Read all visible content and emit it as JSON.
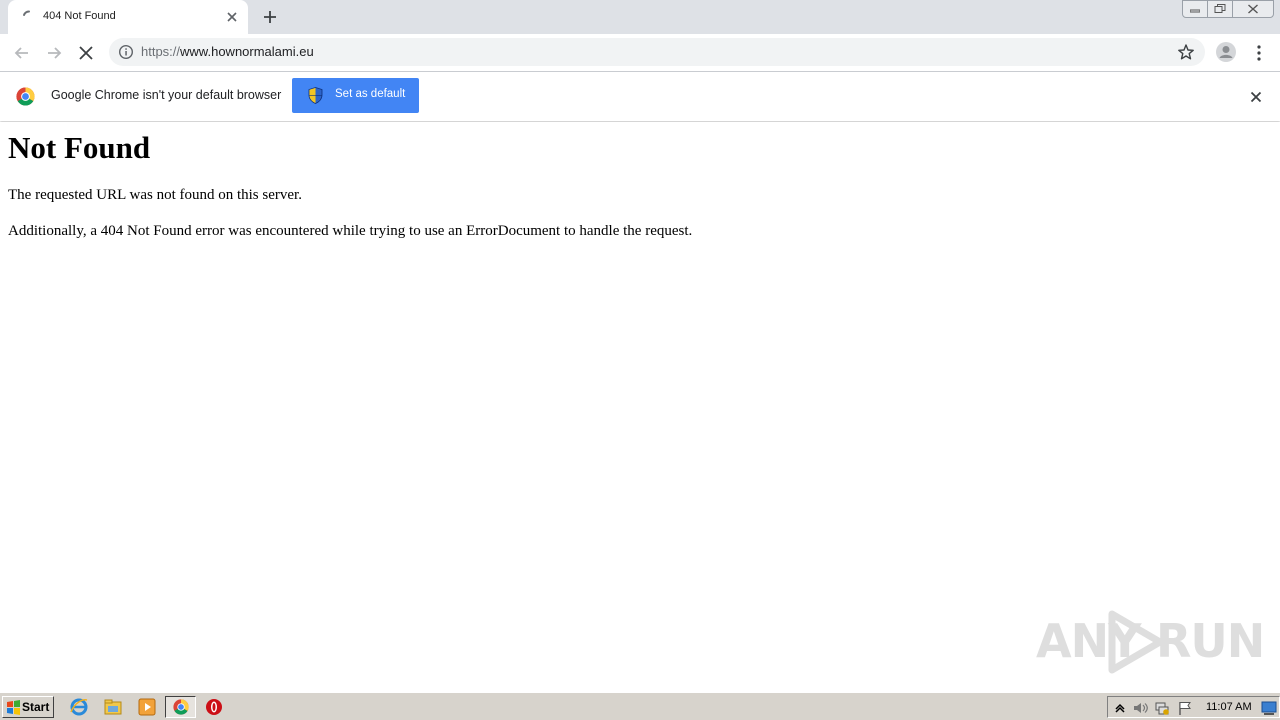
{
  "browser": {
    "tab": {
      "title": "404 Not Found"
    },
    "address_bar": {
      "scheme": "https://",
      "host": "www.hownormalami.eu"
    }
  },
  "infobar": {
    "message": "Google Chrome isn't your default browser",
    "button_label": "Set as default"
  },
  "page": {
    "heading": "Not Found",
    "paragraphs": [
      "The requested URL was not found on this server.",
      "Additionally, a 404 Not Found error was encountered while trying to use an ErrorDocument to handle the request."
    ]
  },
  "watermark": {
    "left": "ANY",
    "right": "RUN"
  },
  "taskbar": {
    "start_label": "Start",
    "clock": "11:07 AM"
  },
  "colors": {
    "accent": "#4285f4",
    "tabstrip": "#dee1e6",
    "omnibox": "#f1f3f4",
    "taskbar": "#d7d3cc"
  }
}
